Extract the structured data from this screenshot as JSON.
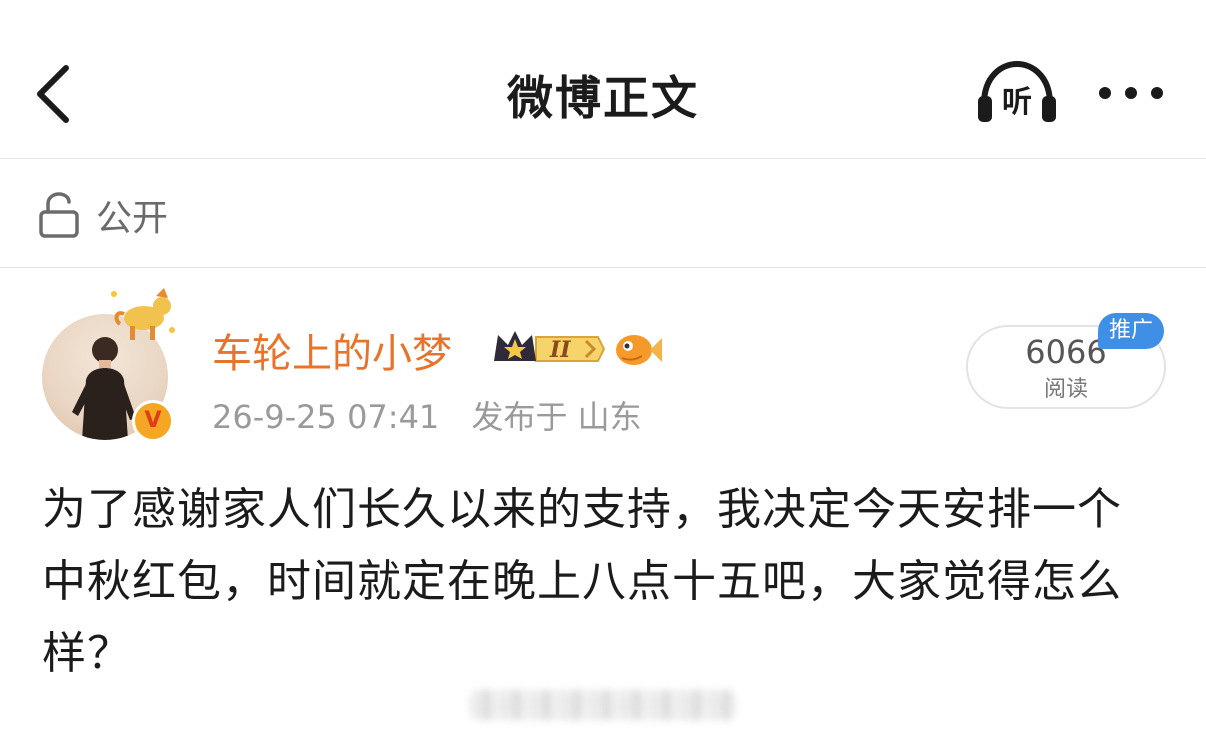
{
  "nav": {
    "title": "微博正文",
    "listen_label": "听"
  },
  "visibility": {
    "label": "公开"
  },
  "author": {
    "name": "车轮上的小梦",
    "vip_level": "II",
    "verified_badge": "V",
    "timestamp": "26-9-25 07:41",
    "location": "发布于 山东"
  },
  "reads": {
    "count": "6066",
    "label": "阅读",
    "ad_tag": "推广"
  },
  "post": {
    "text": "为了感谢家人们长久以来的支持，我决定今天安排一个中秋红包，时间就定在晚上八点十五吧，大家觉得怎么样？"
  },
  "colors": {
    "author_name": "#e8742b",
    "ad_tag": "#3f8fe6",
    "meta_text": "#9a9a9a",
    "verified_badge": "#f5a623"
  }
}
